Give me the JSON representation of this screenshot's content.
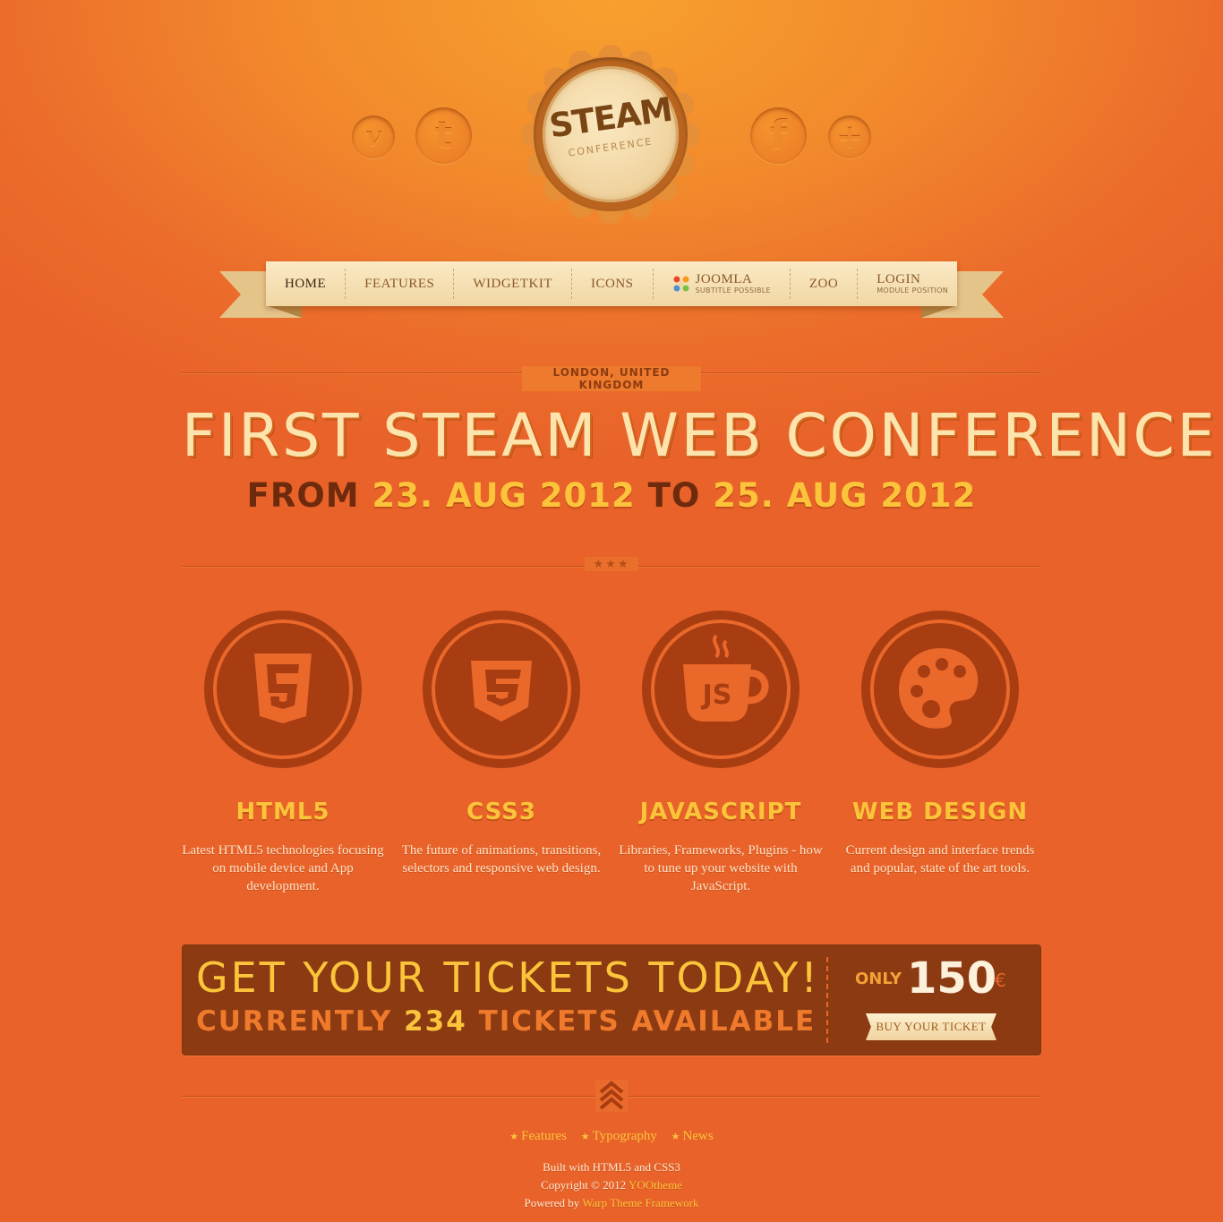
{
  "header": {
    "social": [
      {
        "name": "vimeo",
        "glyph": "v"
      },
      {
        "name": "twitter",
        "glyph": "t"
      },
      {
        "name": "facebook",
        "glyph": "f"
      },
      {
        "name": "google-plus",
        "glyph": "+"
      }
    ],
    "logo": {
      "title": "STEAM",
      "subtitle": "CONFERENCE"
    }
  },
  "nav": {
    "items": [
      {
        "label": "HOME",
        "active": true
      },
      {
        "label": "FEATURES"
      },
      {
        "label": "WIDGETKIT"
      },
      {
        "label": "ICONS"
      },
      {
        "label": "JOOMLA",
        "subtitle": "SUBTITLE POSSIBLE",
        "icon": "joomla-icon"
      },
      {
        "label": "ZOO"
      },
      {
        "label": "LOGIN",
        "subtitle": "MODULE POSITION"
      }
    ]
  },
  "hero": {
    "location": "LONDON, UNITED KINGDOM",
    "title": "FIRST STEAM WEB CONFERENCE",
    "from_label": "FROM",
    "start_date": "23. AUG 2012",
    "to_label": "TO",
    "end_date": "25. AUG 2012",
    "divider": "★★★"
  },
  "features": [
    {
      "title": "HTML5",
      "icon": "html5-icon",
      "description": "Latest HTML5 technologies focusing on mobile device and App development."
    },
    {
      "title": "CSS3",
      "icon": "css3-icon",
      "description": "The future of animations, transitions, selectors and responsive web design."
    },
    {
      "title": "JAVASCRIPT",
      "icon": "javascript-cup-icon",
      "description": "Libraries, Frameworks, Plugins - how to tune up your website with JavaScript."
    },
    {
      "title": "WEB DESIGN",
      "icon": "palette-icon",
      "description": "Current design and interface trends and popular, state of the art tools."
    }
  ],
  "tickets": {
    "headline": "GET YOUR TICKETS TODAY!",
    "currently_label": "CURRENTLY",
    "count": "234",
    "available_label": "TICKETS AVAILABLE",
    "only_label": "ONLY",
    "price": "150",
    "currency": "€",
    "button": "BUY YOUR TICKET"
  },
  "footer": {
    "links": [
      "Features",
      "Typography",
      "News"
    ],
    "built": "Built with HTML5 and CSS3",
    "copyright_prefix": "Copyright © 2012",
    "copyright_link": "YOOtheme",
    "powered_prefix": "Powered by",
    "powered_link": "Warp Theme Framework"
  },
  "colors": {
    "background": "#ec6d2b",
    "accent_yellow": "#fbc43a",
    "dark_brown": "#8c3a12",
    "cream": "#fde4ac"
  }
}
